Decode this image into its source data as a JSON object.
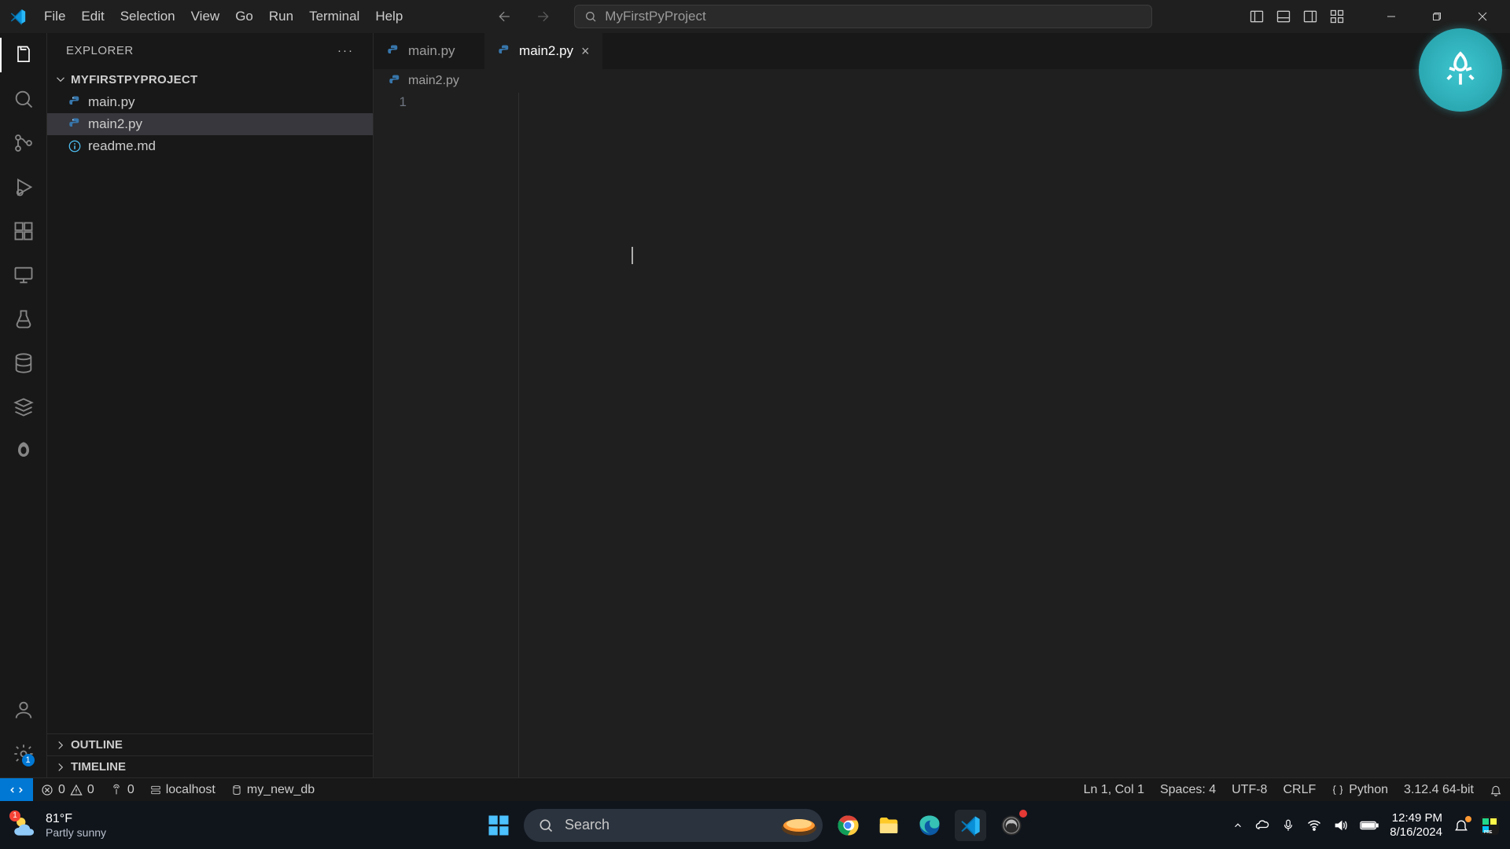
{
  "titlebar": {
    "menus": [
      "File",
      "Edit",
      "Selection",
      "View",
      "Go",
      "Run",
      "Terminal",
      "Help"
    ],
    "search_text": "MyFirstPyProject"
  },
  "activitybar": {
    "items": [
      {
        "name": "explorer",
        "active": true
      },
      {
        "name": "search",
        "active": false
      },
      {
        "name": "source-control",
        "active": false
      },
      {
        "name": "run-debug",
        "active": false
      },
      {
        "name": "extensions",
        "active": false
      },
      {
        "name": "remote-explorer",
        "active": false
      },
      {
        "name": "testing",
        "active": false
      },
      {
        "name": "database",
        "active": false
      },
      {
        "name": "stack",
        "active": false
      },
      {
        "name": "foresight",
        "active": false
      }
    ],
    "settings_badge": "1"
  },
  "sidebar": {
    "panel_title": "EXPLORER",
    "folder_name": "MYFIRSTPYPROJECT",
    "files": [
      {
        "name": "main.py",
        "icon": "python",
        "selected": false
      },
      {
        "name": "main2.py",
        "icon": "python",
        "selected": true
      },
      {
        "name": "readme.md",
        "icon": "info",
        "selected": false
      }
    ],
    "outline_label": "OUTLINE",
    "timeline_label": "TIMELINE"
  },
  "editor": {
    "tabs": [
      {
        "label": "main.py",
        "active": false
      },
      {
        "label": "main2.py",
        "active": true
      }
    ],
    "breadcrumb": "main2.py",
    "line_number": "1"
  },
  "statusbar": {
    "errors": "0",
    "warnings": "0",
    "ports": "0",
    "host": "localhost",
    "db": "my_new_db",
    "position": "Ln 1, Col 1",
    "spaces": "Spaces: 4",
    "encoding": "UTF-8",
    "eol": "CRLF",
    "language": "Python",
    "interpreter": "3.12.4 64-bit"
  },
  "taskbar": {
    "temp": "81°F",
    "condition": "Partly sunny",
    "temp_badge": "1",
    "search_placeholder": "Search",
    "time": "12:49 PM",
    "date": "8/16/2024"
  }
}
